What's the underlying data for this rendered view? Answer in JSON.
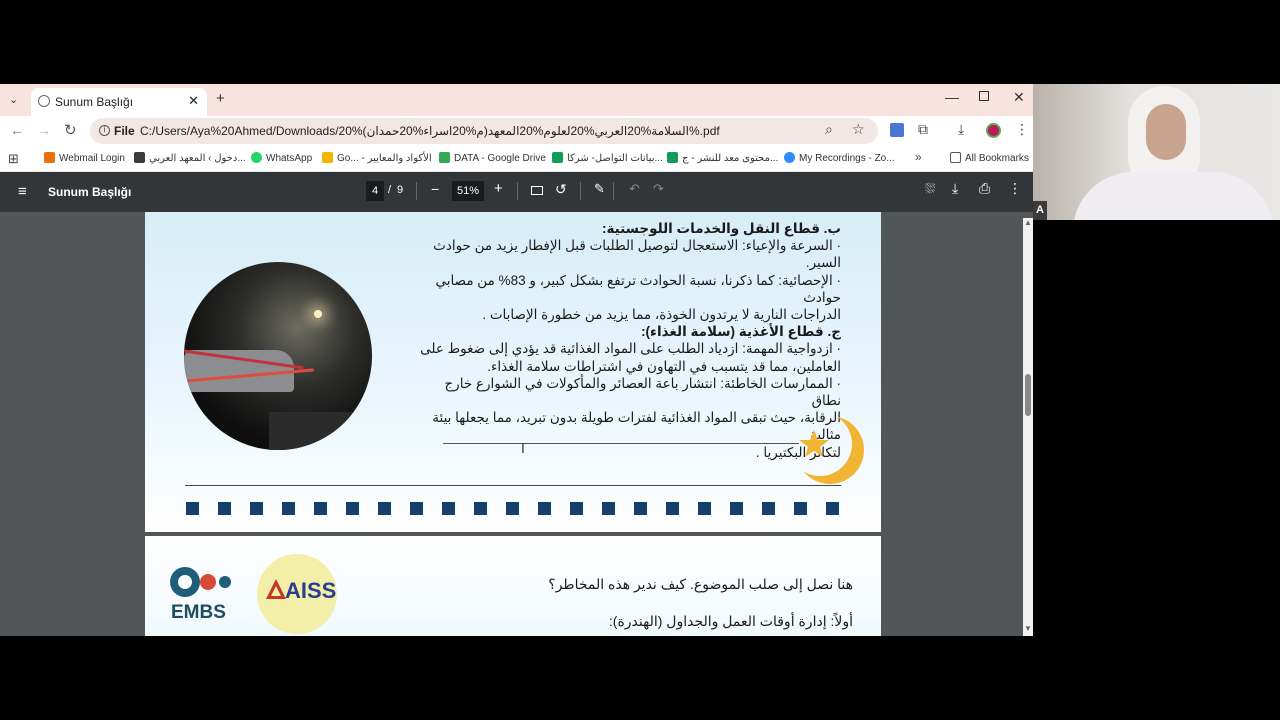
{
  "tab": {
    "title": "Sunum Başlığı"
  },
  "address": {
    "scheme": "File",
    "url": "C:/Users/Aya%20Ahmed/Downloads/20%(م%20اسراء%20حمدان)السلامة%20العربي%20لعلوم%20المعهد%.pdf"
  },
  "bookmarks": [
    {
      "label": "Webmail Login",
      "color": "#e8710a"
    },
    {
      "label": "دخول › المعهد العربي...",
      "color": "#3a3a3a"
    },
    {
      "label": "WhatsApp",
      "color": "#25d366"
    },
    {
      "label": "Go... - الأكواد والمعايير",
      "color": "#f4b400"
    },
    {
      "label": "DATA - Google Drive",
      "color": "#34a853"
    },
    {
      "label": "بيانات التواصل- شركا...",
      "color": "#0f9d58"
    },
    {
      "label": "محتوى معد للنشر - ج...",
      "color": "#0f9d58"
    },
    {
      "label": "My Recordings - Zo...",
      "color": "#2d8cff"
    },
    {
      "label": "All Bookmarks",
      "color": "#555555"
    }
  ],
  "pdf": {
    "title": "Sunum Başlığı",
    "page_current": "4",
    "page_sep": "/",
    "page_total": "9",
    "zoom": "51%"
  },
  "page1": {
    "lines": [
      "ب. قطاع النقل والخدمات اللوجستية:",
      "· السرعة والإعياء: الاستعجال لتوصيل الطلبات قبل الإفطار يزيد من حوادث السير.",
      "· الإحصائية: كما ذكرنا، نسبة الحوادث ترتفع بشكل كبير، و 83% من مصابي حوادث",
      "الدراجات النارية لا يرتدون الخوذة، مما يزيد من خطورة الإصابات .",
      "ج. قطاع الأغذية (سلامة الغذاء):",
      "· ازدواجية المهمة: ازدياد الطلب على المواد الغذائية قد يؤدي إلى ضغوط على",
      "العاملين، مما قد يتسبب في التهاون في اشتراطات سلامة الغذاء.",
      "· الممارسات الخاطئة: انتشار باعة العصائر والمأكولات في الشوارع خارج نطاق",
      "الرقابة، حيث تبقى المواد الغذائية لفترات طويلة بدون تبريد، مما يجعلها بيئة مثالية",
      "لتكاثر البكتيريا ."
    ]
  },
  "page2": {
    "intro": "هنا نصل إلى صلب الموضوع. كيف ندير هذه المخاطر؟",
    "heading": "أولاً: إدارة أوقات العمل والجداول (الهندرة):",
    "logo_left": "EMBS",
    "logo_right": "AISS"
  },
  "webcam": {
    "badge": "A"
  }
}
